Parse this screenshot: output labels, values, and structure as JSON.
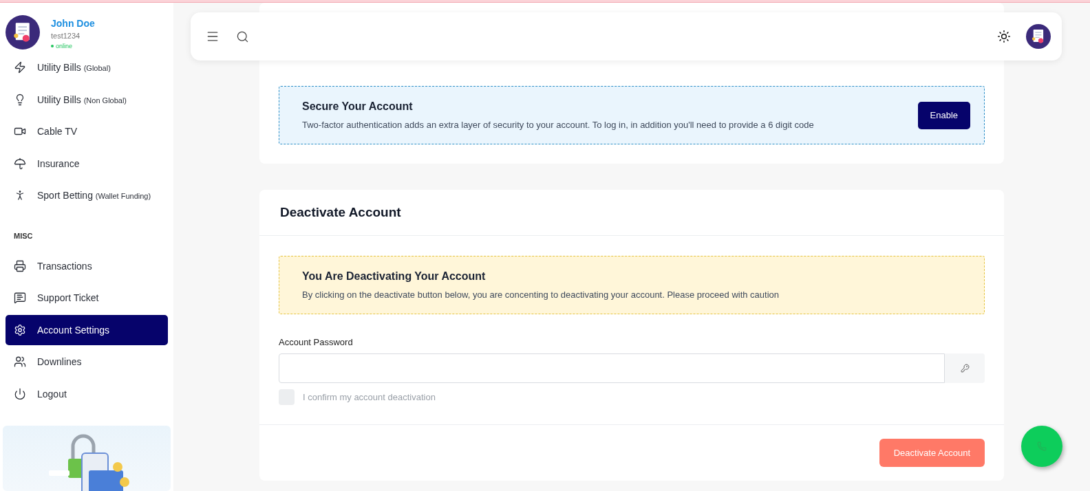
{
  "user": {
    "name": "John Doe",
    "username": "test1234",
    "status": "online",
    "online": true
  },
  "sidebar": {
    "items": [
      {
        "label": "Utility Bills",
        "note": "(Global)",
        "selected": false
      },
      {
        "label": "Utility Bills",
        "note": "(Non Global)",
        "selected": false
      },
      {
        "label": "Cable TV",
        "selected": false
      },
      {
        "label": "Insurance",
        "selected": false
      },
      {
        "label": "Sport Betting",
        "note": "(Wallet Funding)",
        "selected": false
      }
    ],
    "section": "MISC",
    "misc_items": [
      {
        "label": "Transactions",
        "selected": false
      },
      {
        "label": "Support Ticket",
        "selected": false
      },
      {
        "label": "Account Settings",
        "selected": true
      },
      {
        "label": "Downlines",
        "selected": false
      },
      {
        "label": "Logout",
        "selected": false
      }
    ]
  },
  "two_factor": {
    "title": "Secure Your Account",
    "text": "Two-factor authentication adds an extra layer of security to your account. To log in, in addition you'll need to provide a 6 digit code",
    "button": "Enable"
  },
  "deactivate": {
    "title": "Deactivate Account",
    "warning_title": "You Are Deactivating Your Account",
    "warning_text": "By clicking on the deactivate button below, you are concenting to deactivating your account. Please proceed with caution",
    "password_label": "Account Password",
    "confirm_label": "I confirm my account deactivation",
    "confirm_checked": false,
    "button": "Deactivate Account",
    "button_disabled": true
  }
}
